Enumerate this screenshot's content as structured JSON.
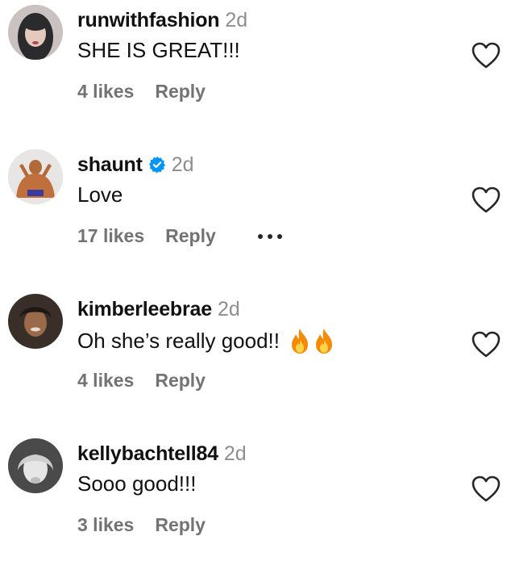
{
  "comments": [
    {
      "username": "runwithfashion",
      "time": "2d",
      "text": "SHE IS GREAT!!!",
      "likes": "4 likes",
      "reply": "Reply",
      "verified": false,
      "fires": 0,
      "more": false
    },
    {
      "username": "shaunt",
      "time": "2d",
      "text": "Love",
      "likes": "17 likes",
      "reply": "Reply",
      "verified": true,
      "fires": 0,
      "more": true
    },
    {
      "username": "kimberleebrae",
      "time": "2d",
      "text": "Oh she’s really good!!",
      "likes": "4 likes",
      "reply": "Reply",
      "verified": false,
      "fires": 2,
      "more": false
    },
    {
      "username": "kellybachtell84",
      "time": "2d",
      "text": "Sooo good!!!",
      "likes": "3 likes",
      "reply": "Reply",
      "verified": false,
      "fires": 0,
      "more": false
    }
  ],
  "icons": {
    "like": "heart-outline-icon",
    "verified": "verified-badge-icon",
    "more": "more-options-icon",
    "emoji": "fire-emoji"
  },
  "colors": {
    "verified_blue": "#0095f6",
    "secondary_text": "#737373",
    "timestamp": "#8e8e8e",
    "fire": "#f58a07"
  }
}
